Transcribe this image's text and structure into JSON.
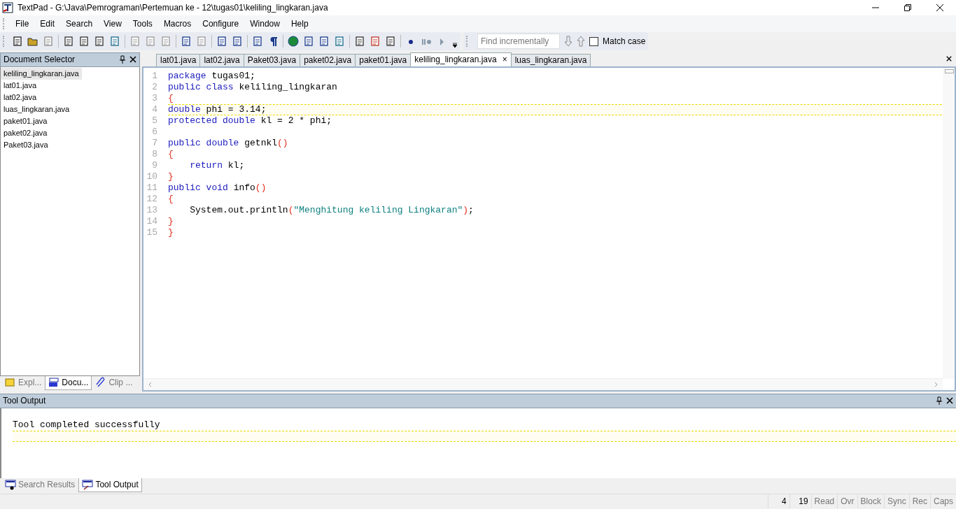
{
  "window": {
    "title": "TextPad - G:\\Java\\Pemrograman\\Pertemuan ke - 12\\tugas01\\keliling_lingkaran.java"
  },
  "menu": [
    "File",
    "Edit",
    "Search",
    "View",
    "Tools",
    "Macros",
    "Configure",
    "Window",
    "Help"
  ],
  "find_bar": {
    "placeholder": "Find incrementally",
    "match_case": {
      "label": "Match case",
      "checked": false
    }
  },
  "document_selector": {
    "title": "Document Selector",
    "items": [
      {
        "label": "keliling_lingkaran.java",
        "selected": true
      },
      {
        "label": "lat01.java",
        "selected": false
      },
      {
        "label": "lat02.java",
        "selected": false
      },
      {
        "label": "luas_lingkaran.java",
        "selected": false
      },
      {
        "label": "paket01.java",
        "selected": false
      },
      {
        "label": "paket02.java",
        "selected": false
      },
      {
        "label": "Paket03.java",
        "selected": false
      }
    ],
    "tabs": [
      {
        "label": "Expl...",
        "kind": "explorer",
        "selected": false
      },
      {
        "label": "Docu...",
        "kind": "documents",
        "selected": true
      },
      {
        "label": "Clip ...",
        "kind": "clip",
        "selected": false
      }
    ]
  },
  "editor_tabs": [
    {
      "label": "lat01.java",
      "selected": false
    },
    {
      "label": "lat02.java",
      "selected": false
    },
    {
      "label": "Paket03.java",
      "selected": false
    },
    {
      "label": "paket02.java",
      "selected": false
    },
    {
      "label": "paket01.java",
      "selected": false
    },
    {
      "label": "keliling_lingkaran.java",
      "selected": true,
      "close": "×"
    },
    {
      "label": "luas_lingkaran.java",
      "selected": false
    }
  ],
  "editor": {
    "lines": [
      {
        "number": "1",
        "current": false,
        "tokens": [
          {
            "kind": "keyword",
            "text": "package"
          },
          {
            "kind": "plain",
            "text": " tugas01;"
          }
        ]
      },
      {
        "number": "2",
        "current": false,
        "tokens": [
          {
            "kind": "keyword",
            "text": "public class"
          },
          {
            "kind": "plain",
            "text": " keliling_lingkaran"
          }
        ]
      },
      {
        "number": "3",
        "current": false,
        "tokens": [
          {
            "kind": "brace",
            "text": "{"
          }
        ]
      },
      {
        "number": "4",
        "current": true,
        "tokens": [
          {
            "kind": "keyword",
            "text": "double"
          },
          {
            "kind": "plain",
            "text": " phi = 3.14;"
          }
        ]
      },
      {
        "number": "5",
        "current": false,
        "tokens": [
          {
            "kind": "keyword",
            "text": "protected double"
          },
          {
            "kind": "plain",
            "text": " kl = 2 * phi;"
          }
        ]
      },
      {
        "number": "6",
        "current": false
      },
      {
        "number": "7",
        "current": false,
        "tokens": [
          {
            "kind": "keyword",
            "text": "public double"
          },
          {
            "kind": "plain",
            "text": " getnkl"
          },
          {
            "kind": "brace",
            "text": "()"
          }
        ]
      },
      {
        "number": "8",
        "current": false,
        "tokens": [
          {
            "kind": "brace",
            "text": "{"
          }
        ]
      },
      {
        "number": "9",
        "current": false,
        "indent": true,
        "tokens": [
          {
            "kind": "keyword",
            "text": "return"
          },
          {
            "kind": "plain",
            "text": " kl;"
          }
        ]
      },
      {
        "number": "10",
        "current": false,
        "tokens": [
          {
            "kind": "brace",
            "text": "}"
          }
        ]
      },
      {
        "number": "11",
        "current": false,
        "tokens": [
          {
            "kind": "keyword",
            "text": "public void"
          },
          {
            "kind": "plain",
            "text": " info"
          },
          {
            "kind": "brace",
            "text": "()"
          }
        ]
      },
      {
        "number": "12",
        "current": false,
        "tokens": [
          {
            "kind": "brace",
            "text": "{"
          }
        ]
      },
      {
        "number": "13",
        "current": false,
        "indent": true,
        "tokens": [
          {
            "kind": "plain",
            "text": "System.out.println"
          },
          {
            "kind": "brace",
            "text": "("
          },
          {
            "kind": "string",
            "text": "\"Menghitung keliling Lingkaran\""
          },
          {
            "kind": "brace",
            "text": ")"
          },
          {
            "kind": "plain",
            "text": ";"
          }
        ]
      },
      {
        "number": "14",
        "current": false,
        "tokens": [
          {
            "kind": "brace",
            "text": "}"
          }
        ]
      },
      {
        "number": "15",
        "current": false,
        "tokens": [
          {
            "kind": "brace",
            "text": "}"
          }
        ]
      }
    ]
  },
  "tool_output": {
    "title": "Tool Output",
    "lines": [
      {
        "text": "Tool completed successfully",
        "current": false
      },
      {
        "current": true
      }
    ],
    "tabs": [
      {
        "label": "Search Results",
        "kind": "search",
        "selected": false
      },
      {
        "label": "Tool Output",
        "kind": "output",
        "selected": true
      }
    ]
  },
  "status_bar": {
    "line": "4",
    "column": "19",
    "indicators": [
      {
        "label": "Read",
        "on": false
      },
      {
        "label": "Ovr",
        "on": false
      },
      {
        "label": "Block",
        "on": false
      },
      {
        "label": "Sync",
        "on": false
      },
      {
        "label": "Rec",
        "on": false
      },
      {
        "label": "Caps",
        "on": false
      }
    ]
  }
}
